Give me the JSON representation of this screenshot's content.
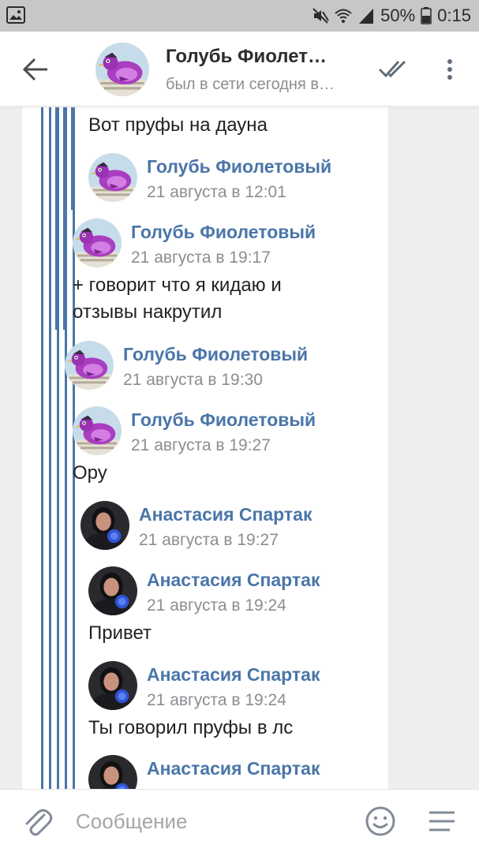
{
  "status_bar": {
    "battery_percent": "50%",
    "time": "0:15",
    "icons": [
      "image-icon",
      "mute-icon",
      "wifi-icon",
      "signal-icon",
      "battery-icon"
    ]
  },
  "header": {
    "name": "Голубь Фиолет…",
    "status": "был в сети сегодня в…",
    "icons": [
      "back-arrow-icon",
      "double-check-icon",
      "more-vert-icon"
    ]
  },
  "messages": [
    {
      "text": "Вот пруфы на дауна"
    },
    {
      "author": "Голубь Фиолетовый",
      "date": "21 августа в 12:01"
    },
    {
      "author": "Голубь Фиолетовый",
      "date": "21 августа в 19:17",
      "text_line1": "+ говорит что я кидаю и",
      "text_line2": "отзывы накрутил"
    },
    {
      "author": "Голубь Фиолетовый",
      "date": "21 августа в 19:30"
    },
    {
      "author": "Голубь Фиолетовый",
      "date": "21 августа в 19:27",
      "text": "Ору"
    },
    {
      "author": "Анастасия Спартак",
      "date": "21 августа в 19:27"
    },
    {
      "author": "Анастасия Спартак",
      "date": "21 августа в 19:24",
      "text": "Привет"
    },
    {
      "author": "Анастасия Спартак",
      "date": "21 августа в 19:24",
      "text": "Ты говорил пруфы в лс"
    },
    {
      "author": "Анастасия Спартак"
    }
  ],
  "composer": {
    "placeholder": "Сообщение",
    "icons": [
      "paperclip-icon",
      "smile-icon",
      "menu-icon"
    ]
  },
  "colors": {
    "accent": "#4a76a8",
    "background": "#edeef0",
    "status_bar": "#c7c7c7"
  }
}
